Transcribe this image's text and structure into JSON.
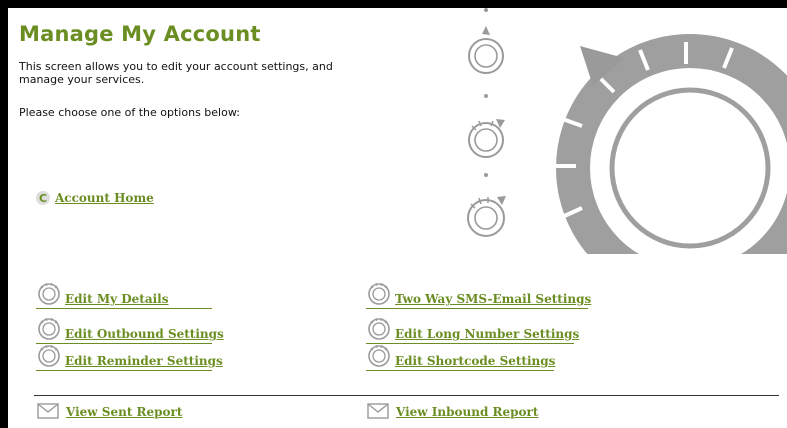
{
  "page": {
    "title": "Manage My Account",
    "description": "This screen allows you to edit your account settings, and manage your services.",
    "instruction": "Please choose one of the options below:"
  },
  "account_home": {
    "label": "Account Home",
    "icon": "back-arrow-icon"
  },
  "options": {
    "left": [
      {
        "label": "Edit My Details",
        "icon": "dial-icon"
      },
      {
        "label": "Edit Outbound Settings",
        "icon": "dial-icon"
      },
      {
        "label": "Edit Reminder Settings",
        "icon": "dial-icon"
      }
    ],
    "right": [
      {
        "label": "Two Way SMS-Email Settings",
        "icon": "dial-icon"
      },
      {
        "label": "Edit Long Number Settings",
        "icon": "dial-icon"
      },
      {
        "label": "Edit Shortcode Settings",
        "icon": "dial-icon"
      }
    ]
  },
  "reports": [
    {
      "label": "View Sent Report",
      "icon": "envelope-icon"
    },
    {
      "label": "View Inbound Report",
      "icon": "envelope-icon"
    }
  ],
  "colors": {
    "accent": "#6b8e23",
    "dial": "#9a9a9a",
    "frame": "#000000"
  }
}
